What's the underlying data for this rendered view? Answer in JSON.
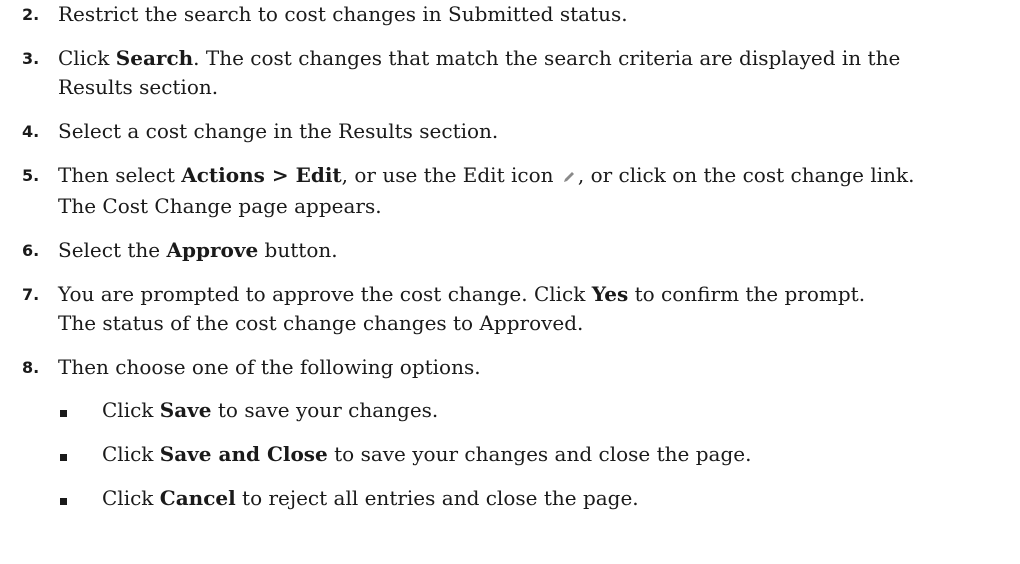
{
  "steps": [
    {
      "num": "2.",
      "text": "Restrict the search to cost changes in Submitted status."
    },
    {
      "num": "3.",
      "pre": "Click ",
      "bold": "Search",
      "post_line1": ". The cost changes that match the search criteria are displayed in the",
      "post_line2": "Results section."
    },
    {
      "num": "4.",
      "text": "Select a cost change in the Results section."
    },
    {
      "num": "5.",
      "pre": "Then select ",
      "bold": "Actions > Edit",
      "mid": ", or use the Edit icon ",
      "post_line1": ", or click on the cost change link.",
      "post_line2": "The Cost Change page appears.",
      "icon": "pencil-icon"
    },
    {
      "num": "6.",
      "pre": "Select the ",
      "bold": "Approve",
      "post": " button."
    },
    {
      "num": "7.",
      "pre": "You are prompted to approve the cost change. Click ",
      "bold": "Yes",
      "post_line1": " to confirm the prompt.",
      "post_line2": "The status of the cost change changes to Approved."
    },
    {
      "num": "8.",
      "text": "Then choose one of the following options."
    }
  ],
  "options": [
    {
      "pre": "Click ",
      "bold": "Save",
      "post": " to save your changes."
    },
    {
      "pre": "Click ",
      "bold": "Save and Close",
      "post": " to save your changes and close the page."
    },
    {
      "pre": "Click ",
      "bold": "Cancel",
      "post": " to reject all entries and close the page."
    }
  ]
}
